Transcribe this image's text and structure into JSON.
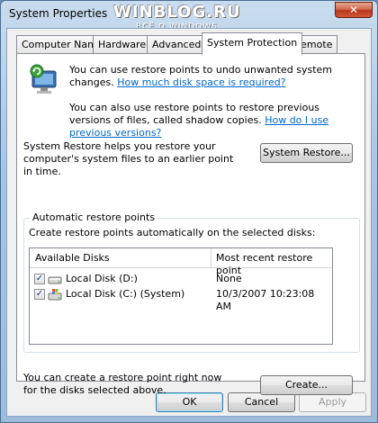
{
  "window": {
    "title": "System Properties"
  },
  "watermark": {
    "main": "WINBLOG.RU",
    "sub": "ВСЁ О WINDOWS"
  },
  "titlebar": {
    "close_glyph": "✕"
  },
  "tabs": [
    {
      "label": "Computer Name"
    },
    {
      "label": "Hardware"
    },
    {
      "label": "Advanced"
    },
    {
      "label": "System Protection",
      "active": true
    },
    {
      "label": "Remote"
    }
  ],
  "intro": {
    "line1_text": "You can use restore points to undo unwanted system changes.",
    "line1_link": "How much disk space is required?",
    "line2_text": "You can also use restore points to restore previous versions of files, called shadow copies.",
    "line2_link": "How do I use previous versions?"
  },
  "system_restore": {
    "description": "System Restore helps you restore your computer's system files to an earlier point in time.",
    "button": "System Restore..."
  },
  "auto_restore": {
    "group_label": "Automatic restore points",
    "instruction": "Create restore points automatically on the selected disks:",
    "columns": [
      "Available Disks",
      "Most recent restore point"
    ],
    "disks": [
      {
        "name": "Local Disk (D:)",
        "restore_point": "None",
        "checked": true,
        "icon": "drive-icon"
      },
      {
        "name": "Local Disk (C:) (System)",
        "restore_point": "10/3/2007 10:23:08 AM",
        "checked": true,
        "icon": "system-drive-icon"
      }
    ]
  },
  "create": {
    "description": "You can create a restore point right now for the disks selected above.",
    "button": "Create..."
  },
  "footer": {
    "ok": "OK",
    "cancel": "Cancel",
    "apply": "Apply"
  },
  "check_glyph": "✓"
}
